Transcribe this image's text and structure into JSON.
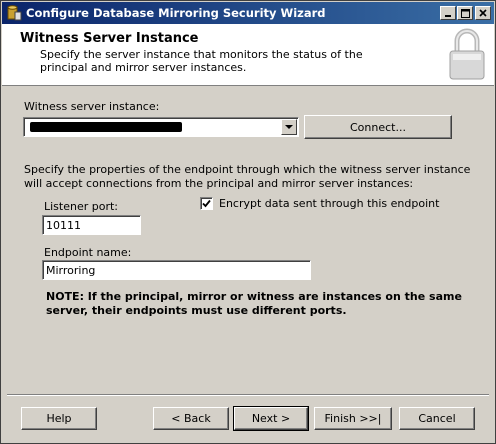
{
  "window": {
    "title": "Configure Database Mirroring Security Wizard",
    "minimize_icon": "minimize-icon",
    "maximize_icon": "maximize-icon",
    "close_icon": "close-icon"
  },
  "header": {
    "title": "Witness Server Instance",
    "description": "Specify the server instance that monitors the status of the principal and mirror server instances.",
    "icon": "padlock-icon"
  },
  "witness": {
    "label": "Witness server instance:",
    "selected_value": "",
    "connect_label": "Connect..."
  },
  "endpoint": {
    "description": "Specify the properties of the endpoint through which the witness server instance will accept connections from the principal and mirror server instances:",
    "listener_port_label": "Listener port:",
    "listener_port_value": "10111",
    "encrypt_label": "Encrypt data sent through this endpoint",
    "encrypt_checked": true,
    "endpoint_name_label": "Endpoint name:",
    "endpoint_name_value": "Mirroring",
    "note": "NOTE: If the principal, mirror or witness are instances on the same server, their endpoints must use different ports."
  },
  "footer": {
    "help_label": "Help",
    "back_label": "< Back",
    "next_label": "Next >",
    "finish_label": "Finish >>|",
    "cancel_label": "Cancel"
  }
}
